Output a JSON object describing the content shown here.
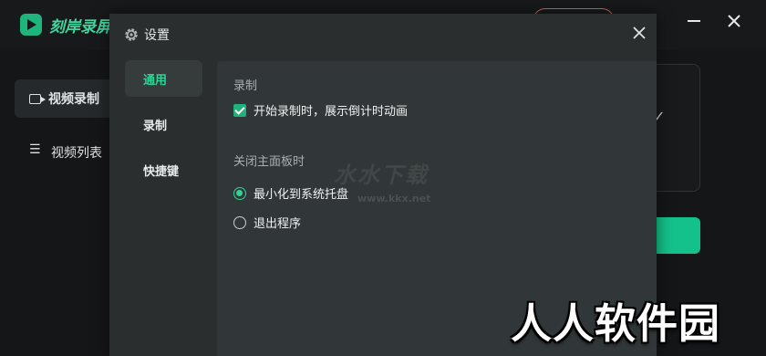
{
  "app": {
    "title": "刻岸录屏大",
    "nav": [
      {
        "label": "视频录制",
        "icon": "video-camera-icon",
        "active": true
      },
      {
        "label": "视频列表",
        "icon": "list-icon",
        "active": false
      }
    ],
    "card_check": "✓"
  },
  "dialog": {
    "title": "设置",
    "icon": "gear-icon",
    "tabs": [
      {
        "label": "通用",
        "active": true
      },
      {
        "label": "录制",
        "active": false
      },
      {
        "label": "快捷键",
        "active": false
      }
    ],
    "sections": {
      "record": {
        "title": "录制",
        "checkbox_label": "开始录制时，展示倒计时动画",
        "checked": true
      },
      "close_panel": {
        "title": "关闭主面板时",
        "options": [
          {
            "label": "最小化到系统托盘",
            "selected": true
          },
          {
            "label": "退出程序",
            "selected": false
          }
        ]
      }
    }
  },
  "watermarks": {
    "faint": "水水下载",
    "faint_url": "www.kkx.net",
    "big": "人人软件园"
  },
  "colors": {
    "accent": "#2fd394",
    "checkbox": "#1fb27b",
    "primary_button": "#14c18a",
    "dialog_bg": "#2a2e2f",
    "content_bg": "#313738"
  }
}
